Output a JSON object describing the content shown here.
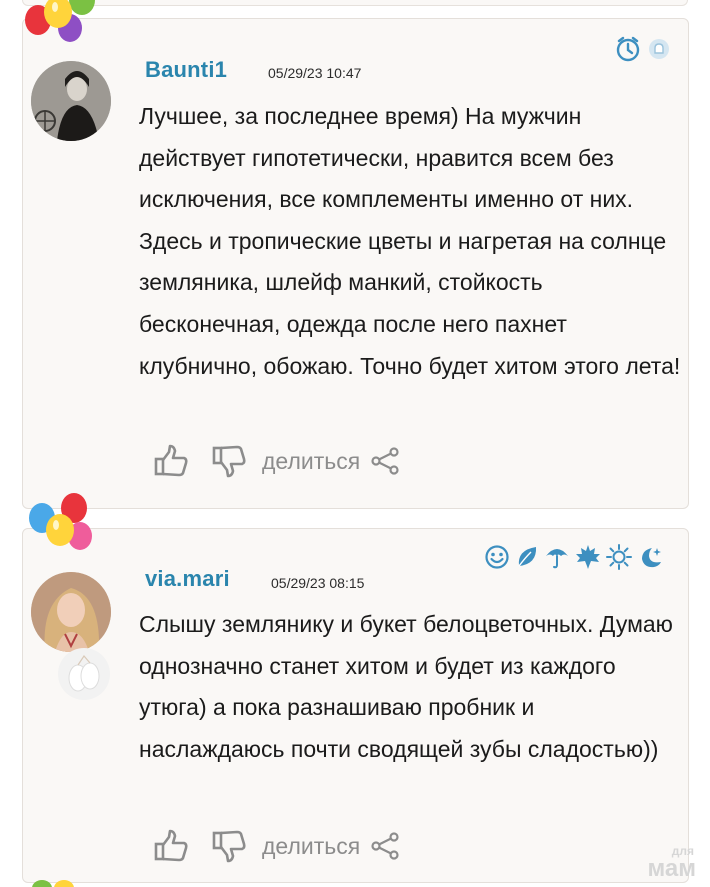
{
  "comments": [
    {
      "username": "Baunti1",
      "timestamp": "05/29/23 10:47",
      "text": "Лучшее, за последнее время) На мужчин действует гипотетически, нравится всем без исключения, все комплементы именно от них. Здесь и тропические цветы и нагретая на солнце земляника, шлейф манкий, стойкость бесконечная, одежда после него пахнет клубнично, обожаю. Точно будет хитом этого лета!",
      "share_label": "делиться",
      "badges": [
        "clock-badge-icon",
        "bell-badge-icon"
      ]
    },
    {
      "username": "via.mari",
      "timestamp": "05/29/23 08:15",
      "text": "Слышу землянику и букет белоцветочных. Думаю однозначно станет хитом и будет из каждого утюга) а пока разнашиваю пробник и наслаждаюсь почти сводящей зубы сладостью))",
      "share_label": "делиться",
      "badges": [
        "smile-badge-icon",
        "leaf-badge-icon",
        "umbrella-badge-icon",
        "maple-leaf-badge-icon",
        "sun-badge-icon",
        "moon-badge-icon"
      ]
    }
  ],
  "watermark": {
    "small": "для",
    "big": "мам"
  },
  "colors": {
    "username": "#2a85ad",
    "icon_blue": "#3d8fc0",
    "card_bg": "#faf8f6",
    "card_border": "#e4dfda",
    "action_gray": "#8c8c8c"
  }
}
